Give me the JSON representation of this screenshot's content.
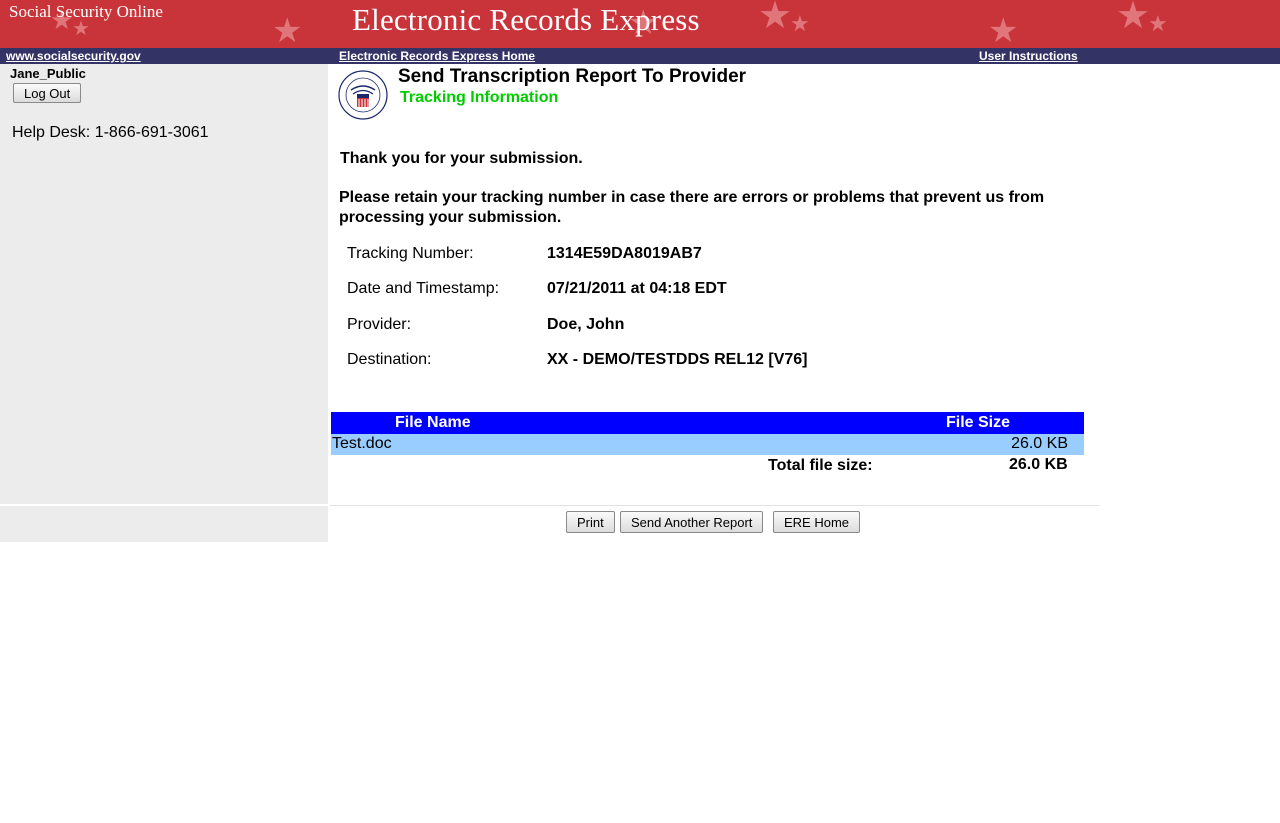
{
  "banner": {
    "site_name": "Social Security Online",
    "title": "Electronic Records Express"
  },
  "nav": {
    "ssa_link": "www.socialsecurity.gov",
    "home_link": "Electronic Records Express Home",
    "instructions_link": "User Instructions"
  },
  "sidebar": {
    "user_name": "Jane_Public",
    "logout_label": "Log Out",
    "helpdesk": "Help Desk: 1-866-691-3061"
  },
  "page": {
    "title": "Send Transcription Report To Provider",
    "subtitle": "Tracking Information",
    "thanks": "Thank you for your submission.",
    "retain_message": "Please retain your tracking number in case there are errors or problems that prevent us from processing your submission."
  },
  "info": [
    {
      "label": "Tracking Number:",
      "value": "1314E59DA8019AB7"
    },
    {
      "label": "Date and Timestamp:",
      "value": "07/21/2011 at 04:18 EDT"
    },
    {
      "label": "Provider:",
      "value": "Doe, John"
    },
    {
      "label": "Destination:",
      "value": "XX - DEMO/TESTDDS REL12 [V76]"
    }
  ],
  "files": {
    "header_name": "File Name",
    "header_size": "File Size",
    "rows": [
      {
        "name": "Test.doc",
        "size": "26.0 KB"
      }
    ],
    "total_label": "Total file size:",
    "total_value": "26.0 KB"
  },
  "buttons": {
    "print": "Print",
    "send_another": "Send Another Report",
    "ere_home": "ERE Home"
  },
  "colors": {
    "banner": "#c9343a",
    "navbar": "#333366",
    "sidebar": "#ececec",
    "subtitle_green": "#00cc00",
    "table_header": "#0000ff",
    "table_row": "#99ccff"
  },
  "icons": {
    "logo": "ssa-seal-icon"
  }
}
